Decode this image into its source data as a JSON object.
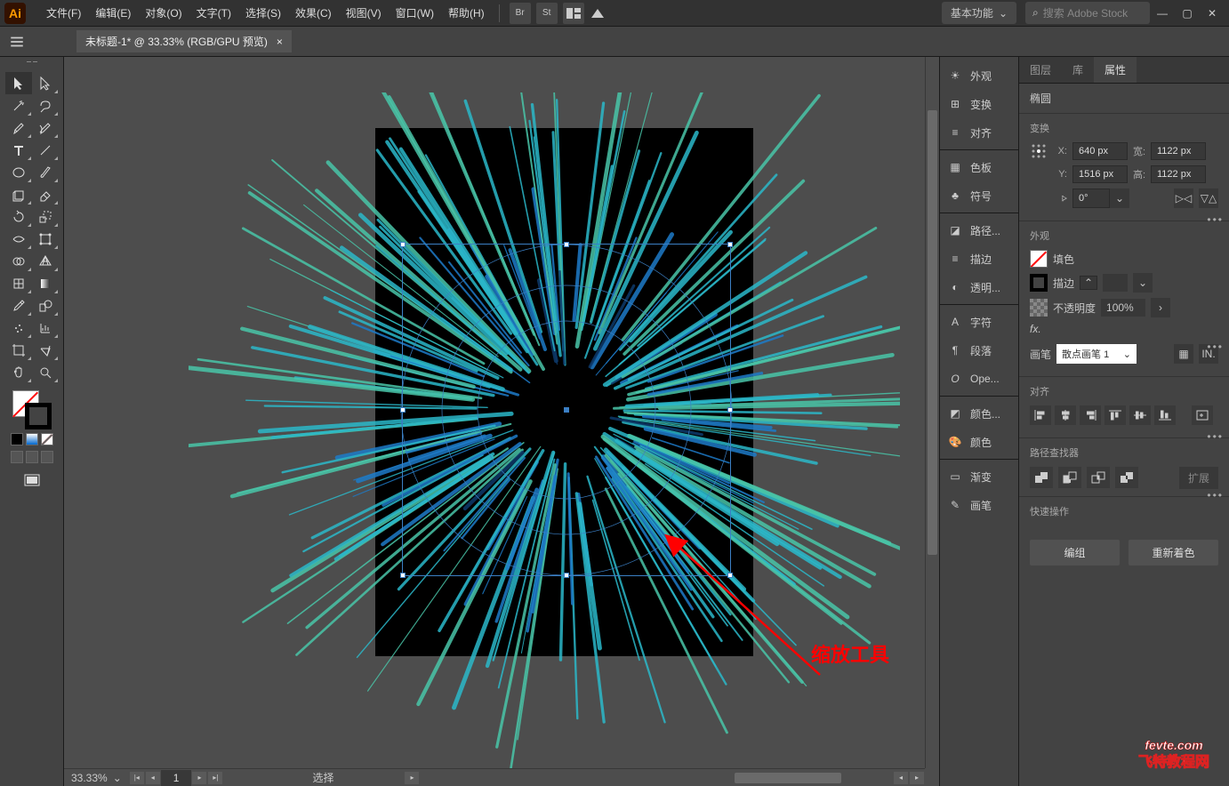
{
  "menubar": {
    "items": [
      "文件(F)",
      "编辑(E)",
      "对象(O)",
      "文字(T)",
      "选择(S)",
      "效果(C)",
      "视图(V)",
      "窗口(W)",
      "帮助(H)"
    ],
    "workspace": "基本功能",
    "search_placeholder": "搜索 Adobe Stock"
  },
  "document": {
    "tab_title": "未标题-1* @ 33.33% (RGB/GPU 预览)",
    "close": "×"
  },
  "mid_panels": {
    "g1": [
      "外观",
      "变换",
      "对齐"
    ],
    "g2": [
      "色板",
      "符号"
    ],
    "g3": [
      "路径...",
      "描边",
      "透明..."
    ],
    "g4": [
      "字符",
      "段落",
      "Ope..."
    ],
    "g5": [
      "颜色...",
      "颜色"
    ],
    "g6": [
      "渐变",
      "画笔"
    ]
  },
  "right": {
    "tabs": [
      "图层",
      "库",
      "属性"
    ],
    "obj_type": "椭圆",
    "transform": {
      "title": "变换",
      "x": "640 px",
      "y": "1516 px",
      "w": "1122 px",
      "h": "1122 px",
      "angle": "0°",
      "x_lbl": "X:",
      "y_lbl": "Y:",
      "w_lbl": "宽:",
      "h_lbl": "高:"
    },
    "appearance": {
      "title": "外观",
      "fill": "填色",
      "stroke": "描边",
      "opacity": "不透明度",
      "opacity_val": "100%",
      "fx": "fx."
    },
    "brush": {
      "label": "画笔",
      "selected": "散点画笔 1"
    },
    "align": {
      "title": "对齐"
    },
    "pathfinder": {
      "title": "路径查找器",
      "expand": "扩展"
    },
    "quick": {
      "title": "快速操作",
      "group": "编组",
      "recolor": "重新着色"
    }
  },
  "status": {
    "zoom": "33.33%",
    "mode": "选择",
    "artboard": "1"
  },
  "annotation": "缩放工具",
  "watermark": {
    "top": "fevte.com",
    "bottom": "飞特教程网"
  }
}
